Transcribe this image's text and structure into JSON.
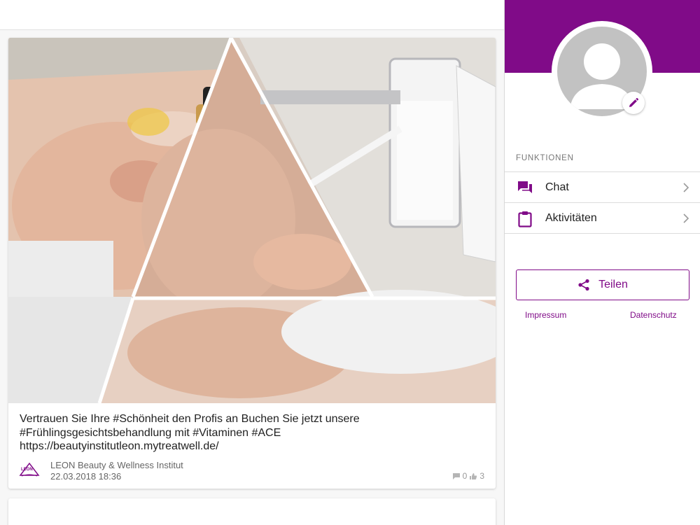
{
  "feed": {
    "post": {
      "text_lines": [
        "Vertrauen Sie Ihre #Schönheit den Profis an Buchen Sie jetzt unsere",
        "#Frühlingsgesichtsbehandlung mit #Vitaminen #ACE",
        "https://beautyinstitutleon.mytreatwell.de/"
      ],
      "author": "LEON Beauty & Wellness Institut",
      "date": "22.03.2018 18:36",
      "comments": "0",
      "likes": "3",
      "logo_text": "LEON"
    }
  },
  "sidebar": {
    "section_label": "FUNKTIONEN",
    "items": [
      {
        "label": "Chat",
        "icon": "chat-icon"
      },
      {
        "label": "Aktivitäten",
        "icon": "clipboard-icon"
      }
    ],
    "share_label": "Teilen",
    "impressum": "Impressum",
    "datenschutz": "Datenschutz"
  },
  "colors": {
    "brand": "#800b88",
    "avatar_bg": "#c2c2c2"
  }
}
